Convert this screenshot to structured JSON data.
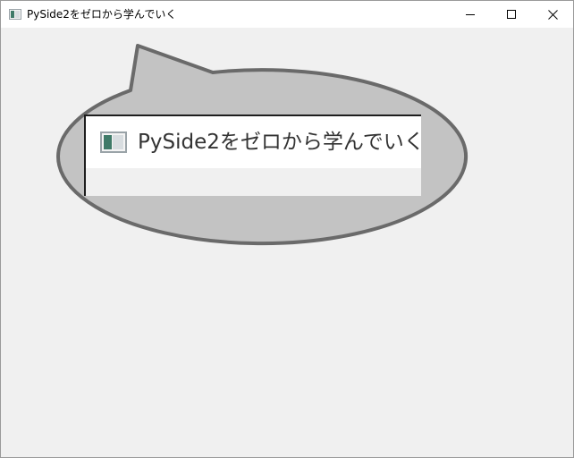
{
  "window": {
    "title": "PySide2をゼロから学んでいく",
    "icon": "app-window-icon",
    "controls": {
      "minimize": "minimize-icon",
      "maximize": "maximize-icon",
      "close": "close-icon"
    }
  },
  "callout": {
    "zoomed_title": "PySide2をゼロから学んでいく",
    "zoomed_icon": "app-window-icon",
    "colors": {
      "fill": "#c3c3c3",
      "stroke": "#6a6a6a"
    }
  },
  "colors": {
    "background": "#f0f0f0",
    "titlebar": "#ffffff"
  }
}
